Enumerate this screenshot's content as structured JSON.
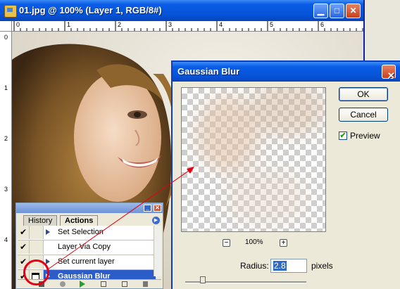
{
  "doc_window": {
    "title": "01.jpg @ 100% (Layer 1, RGB/8#)",
    "minimize_label": "▁",
    "maximize_label": "□",
    "close_label": "✕",
    "ruler_top_numbers": [
      "0",
      "1",
      "2",
      "3",
      "4",
      "5",
      "6"
    ],
    "ruler_left_numbers": [
      "0",
      "1",
      "2",
      "3",
      "4"
    ]
  },
  "actions_panel": {
    "tabs": [
      "History",
      "Actions"
    ],
    "active_tab": "Actions",
    "rows": [
      {
        "label": "Set Selection",
        "checked": true,
        "has_triangle": true,
        "selected": false
      },
      {
        "label": "Layer Via Copy",
        "checked": true,
        "has_triangle": false,
        "selected": false
      },
      {
        "label": "Set current layer",
        "checked": true,
        "has_triangle": true,
        "selected": false
      },
      {
        "label": "Gaussian Blur",
        "checked": true,
        "has_triangle": true,
        "selected": true,
        "dialog_icon": true
      }
    ],
    "check_glyph": "✔"
  },
  "dialog": {
    "title": "Gaussian Blur",
    "close_label": "✕",
    "ok_label": "OK",
    "cancel_label": "Cancel",
    "preview_label": "Preview",
    "preview_checked": true,
    "zoom_out_label": "−",
    "zoom_in_label": "+",
    "zoom_level": "100%",
    "radius_label": "Radius:",
    "radius_value": "2.8",
    "radius_unit": "pixels"
  },
  "annotation_color": "#e40010",
  "selection_color": "#2c5cc8"
}
